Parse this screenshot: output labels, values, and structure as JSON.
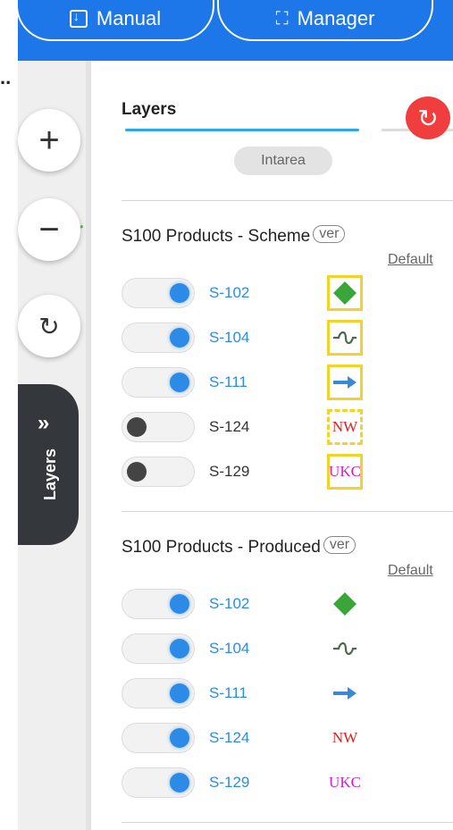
{
  "topbar": {
    "manual_label": "Manual",
    "manager_label": "Manager",
    "ellipsis": "..",
    "accent_color": "#1e77e8"
  },
  "map_controls": {
    "zoom_in": "+",
    "zoom_out": "−",
    "reset": "↻",
    "layers_tab_chevron": "»",
    "layers_tab_label": "Layers"
  },
  "panel": {
    "title": "Layers",
    "chip": "Intarea",
    "refresh_icon": "↻",
    "sections": [
      {
        "title": "S100 Products - Scheme",
        "ver": "ver",
        "default_label": "Default",
        "layers": [
          {
            "name": "S-102",
            "on": true,
            "symbol": "green-diamond",
            "symbol_text": "",
            "symbol_color": "#3aa63a"
          },
          {
            "name": "S-104",
            "on": true,
            "symbol": "wave",
            "symbol_text": "",
            "symbol_color": "#4b6a4b"
          },
          {
            "name": "S-111",
            "on": true,
            "symbol": "arrow",
            "symbol_text": "",
            "symbol_color": "#3a87d6"
          },
          {
            "name": "S-124",
            "on": false,
            "symbol": "text",
            "symbol_text": "NW",
            "symbol_color": "#e02020"
          },
          {
            "name": "S-129",
            "on": false,
            "symbol": "text",
            "symbol_text": "UKC",
            "symbol_color": "#d21bd2"
          }
        ]
      },
      {
        "title": "S100 Products - Produced",
        "ver": "ver",
        "default_label": "Default",
        "layers": [
          {
            "name": "S-102",
            "on": true,
            "symbol": "green-diamond",
            "symbol_text": "",
            "symbol_color": "#3aa63a"
          },
          {
            "name": "S-104",
            "on": true,
            "symbol": "wave",
            "symbol_text": "",
            "symbol_color": "#4b6a4b"
          },
          {
            "name": "S-111",
            "on": true,
            "symbol": "arrow",
            "symbol_text": "",
            "symbol_color": "#3a87d6"
          },
          {
            "name": "S-124",
            "on": true,
            "symbol": "text",
            "symbol_text": "NW",
            "symbol_color": "#e02020"
          },
          {
            "name": "S-129",
            "on": true,
            "symbol": "text",
            "symbol_text": "UKC",
            "symbol_color": "#d21bd2"
          }
        ]
      }
    ]
  }
}
